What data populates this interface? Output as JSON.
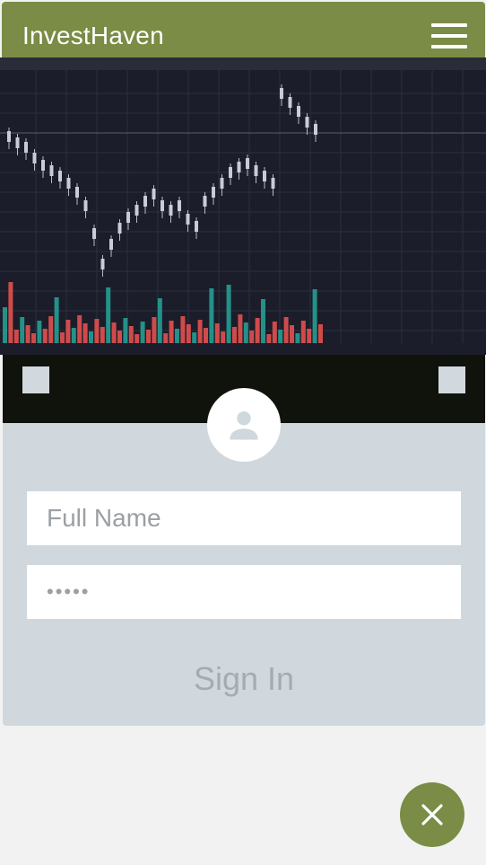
{
  "header": {
    "brand": "InvestHaven",
    "menu_icon": "hamburger-menu-icon"
  },
  "hero": {
    "description_icon": "stock-chart-image"
  },
  "login": {
    "avatar_icon": "person-icon",
    "name_placeholder": "Full Name",
    "password_value": "•••••",
    "signin_label": "Sign In"
  },
  "fab": {
    "icon": "close-icon"
  },
  "colors": {
    "accent": "#7a8c45",
    "card": "#d0d8de",
    "page": "#f2f2f2",
    "chart_bg": "#1b1d2a",
    "up": "#26a69a",
    "down": "#ef5350"
  }
}
